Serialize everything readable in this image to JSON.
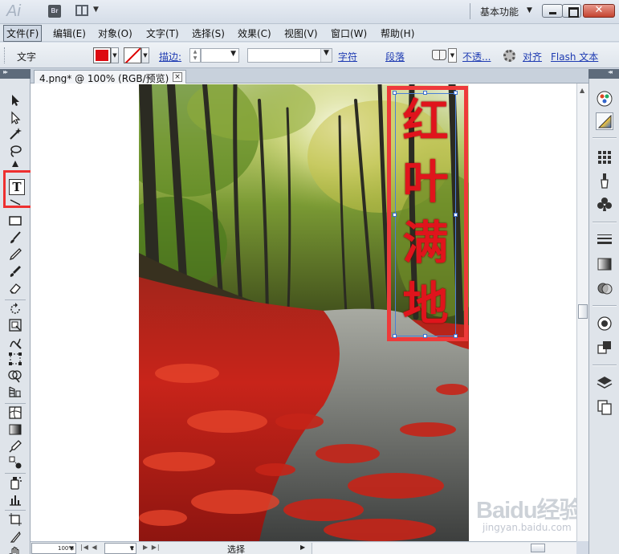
{
  "app": {
    "logo_text": "Ai",
    "bridge_label": "Br",
    "workspace": "基本功能"
  },
  "menu": [
    {
      "label": "文件(F)",
      "active": true
    },
    {
      "label": "编辑(E)",
      "active": false
    },
    {
      "label": "对象(O)",
      "active": false
    },
    {
      "label": "文字(T)",
      "active": false
    },
    {
      "label": "选择(S)",
      "active": false
    },
    {
      "label": "效果(C)",
      "active": false
    },
    {
      "label": "视图(V)",
      "active": false
    },
    {
      "label": "窗口(W)",
      "active": false
    },
    {
      "label": "帮助(H)",
      "active": false
    }
  ],
  "control": {
    "context_label": "文字",
    "fill_color": "#dd0a12",
    "stroke_label": "描边:",
    "character_link": "字符",
    "paragraph_link": "段落",
    "opacity_link": "不透...",
    "align_link": "对齐",
    "flash_text_link": "Flash 文本"
  },
  "document": {
    "tab_title": "4.png* @ 100% (RGB/预览)",
    "close_symbol": "×",
    "artwork_text": [
      "红",
      "叶",
      "满",
      "地"
    ],
    "text_color": "#e0141c",
    "watermark_logo": "Baidu经验",
    "watermark_url": "jingyan.baidu.com"
  },
  "status": {
    "zoom": "100%",
    "page": "1",
    "tool_status": "选择"
  },
  "tools": [
    "selection-tool",
    "direct-selection-tool",
    "magic-wand-tool",
    "lasso-tool",
    "pen-tool",
    "type-tool",
    "line-segment-tool",
    "rectangle-tool",
    "paintbrush-tool",
    "pencil-tool",
    "blob-brush-tool",
    "eraser-tool",
    "rotate-tool",
    "scale-tool",
    "warp-tool",
    "free-transform-tool",
    "shape-builder-tool",
    "perspective-grid-tool",
    "mesh-tool",
    "gradient-tool",
    "eyedropper-tool",
    "blend-tool",
    "symbol-sprayer-tool",
    "column-graph-tool",
    "artboard-tool",
    "slice-tool",
    "hand-tool"
  ],
  "panels": [
    "color-guide-icon",
    "color-icon",
    "swatches-icon",
    "brushes-icon",
    "symbols-icon",
    "stroke-icon",
    "gradient-icon",
    "transparency-icon",
    "appearance-icon",
    "graphic-styles-icon",
    "layers-icon",
    "artboards-icon"
  ]
}
